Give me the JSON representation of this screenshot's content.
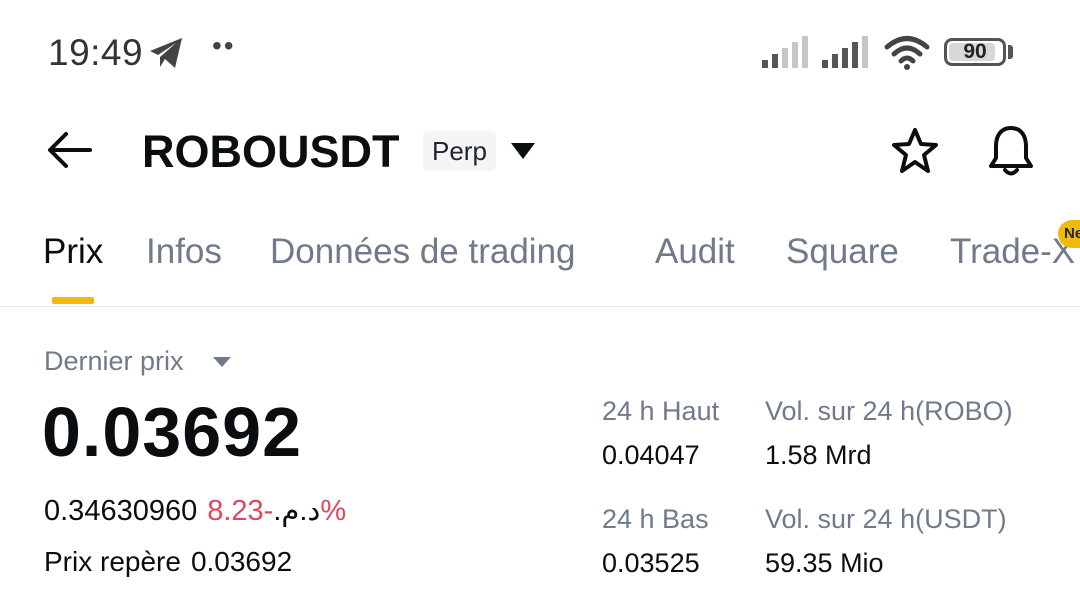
{
  "status_bar": {
    "time": "19:49",
    "notif_dots": "••",
    "battery": "90"
  },
  "header": {
    "symbol": "ROBOUSDT",
    "badge": "Perp"
  },
  "tabs": [
    {
      "label": "Prix",
      "active": true
    },
    {
      "label": "Infos",
      "active": false
    },
    {
      "label": "Données de trading",
      "active": false
    },
    {
      "label": "Audit",
      "active": false
    },
    {
      "label": "Square",
      "active": false
    },
    {
      "label": "Trade-X",
      "active": false
    }
  ],
  "new_badge": "New",
  "price_section": {
    "last_price_label": "Dernier prix",
    "last_price": "0.03692",
    "fiat_value": "0.34630960د.م.",
    "change_pct": "-8.23%",
    "mark_price_label": "Prix repère",
    "mark_price": "0.03692"
  },
  "stats": {
    "high_label": "24 h Haut",
    "high_value": "0.04047",
    "low_label": "24 h Bas",
    "low_value": "0.03525",
    "vol_base_label": "Vol. sur 24 h(ROBO)",
    "vol_base_value": "1.58 Mrd",
    "vol_quote_label": "Vol. sur 24 h(USDT)",
    "vol_quote_value": "59.35 Mio"
  },
  "colors": {
    "accent": "#f0b90b",
    "negative": "#e0475e",
    "muted_text": "#707a8a",
    "primary_text": "#0b0e11"
  }
}
